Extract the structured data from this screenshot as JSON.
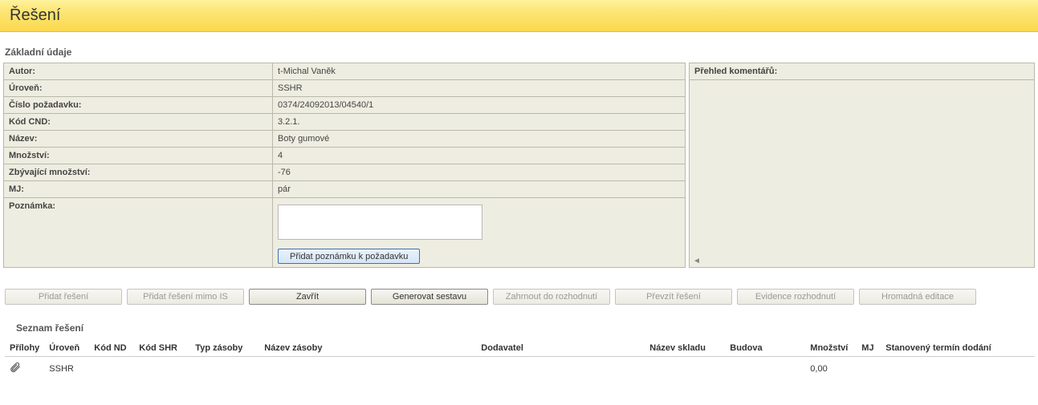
{
  "header": {
    "title": "Řešení"
  },
  "section_basic": {
    "title": "Základní údaje",
    "fields": {
      "autor_label": "Autor:",
      "autor_value": "t-Michal Vaněk",
      "uroven_label": "Úroveň:",
      "uroven_value": "SSHR",
      "cislo_label": "Číslo požadavku:",
      "cislo_value": "0374/24092013/04540/1",
      "kodcnd_label": "Kód CND:",
      "kodcnd_value": "3.2.1.",
      "nazev_label": "Název:",
      "nazev_value": "Boty gumové",
      "mnozstvi_label": "Množství:",
      "mnozstvi_value": "4",
      "zbyvajici_label": "Zbývající množství:",
      "zbyvajici_value": "-76",
      "mj_label": "MJ:",
      "mj_value": "pár",
      "poznamka_label": "Poznámka:",
      "poznamka_value": "",
      "add_note_button": "Přidat poznámku k požadavku"
    }
  },
  "comments": {
    "title": "Přehled komentářů:"
  },
  "buttons": {
    "pridat_reseni": "Přidat řešení",
    "pridat_reseni_mimo": "Přidat řešení mimo IS",
    "zavrit": "Zavřít",
    "generovat": "Generovat sestavu",
    "zahrnout": "Zahrnout do rozhodnutí",
    "prevzit": "Převzít řešení",
    "evidence": "Evidence rozhodnutí",
    "hromadna": "Hromadná editace"
  },
  "list": {
    "title": "Seznam řešení",
    "columns": {
      "prilohy": "Přílohy",
      "uroven": "Úroveň",
      "kodnd": "Kód ND",
      "kodshr": "Kód SHR",
      "typzasoby": "Typ zásoby",
      "nazevzasoby": "Název zásoby",
      "dodavatel": "Dodavatel",
      "nazevskladu": "Název skladu",
      "budova": "Budova",
      "mnozstvi": "Množství",
      "mj": "MJ",
      "termin": "Stanovený termín dodání"
    },
    "rows": [
      {
        "has_attachment": true,
        "uroven": "SSHR",
        "kodnd": "",
        "kodshr": "",
        "typzasoby": "",
        "nazevzasoby": "",
        "dodavatel": "",
        "nazevskladu": "",
        "budova": "",
        "mnozstvi": "0,00",
        "mj": "",
        "termin": ""
      }
    ]
  }
}
